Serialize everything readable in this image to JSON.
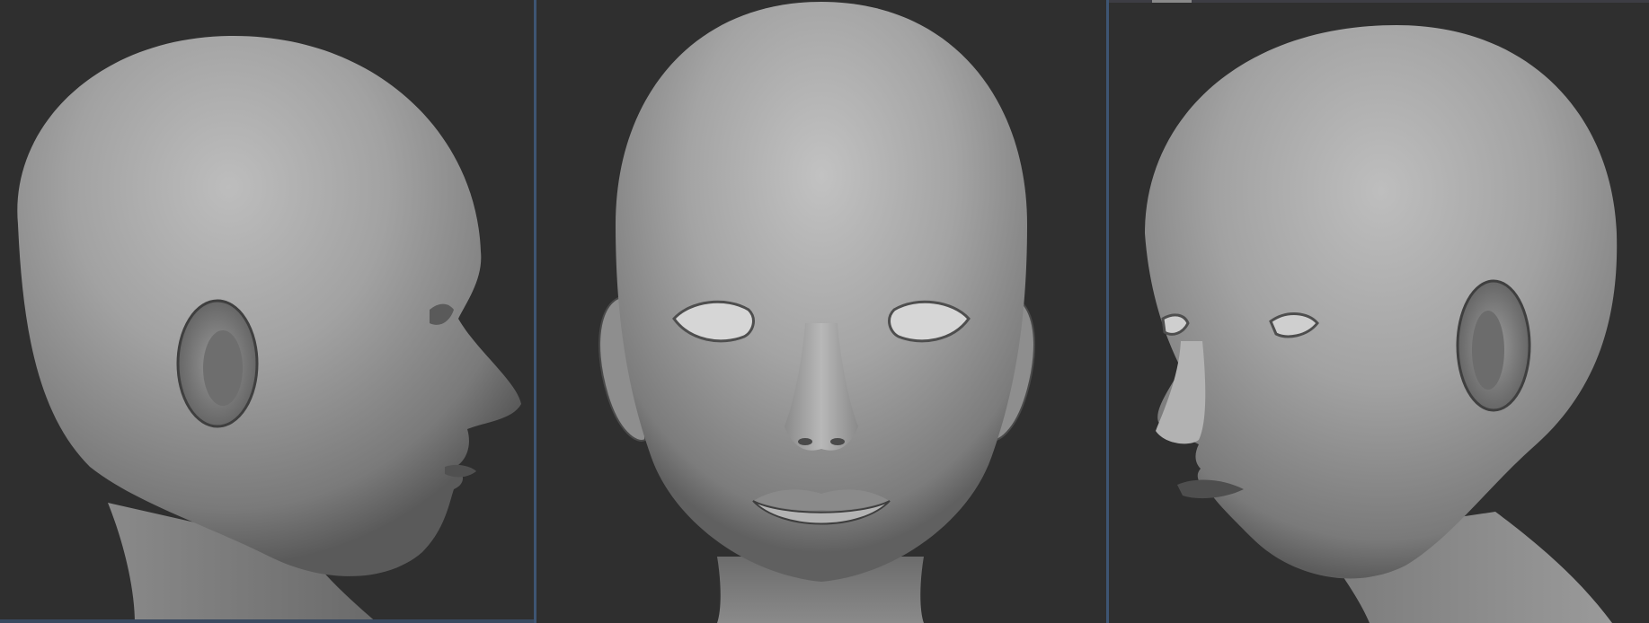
{
  "scene": {
    "background_color": "#2f2f2f",
    "divider_color": "#3e5573",
    "surface_color": "#9a9a9a",
    "views": [
      {
        "id": "left-profile",
        "orientation": "profile-right-facing"
      },
      {
        "id": "front",
        "orientation": "front"
      },
      {
        "id": "three-quarter",
        "orientation": "three-quarter-left-facing"
      }
    ]
  }
}
